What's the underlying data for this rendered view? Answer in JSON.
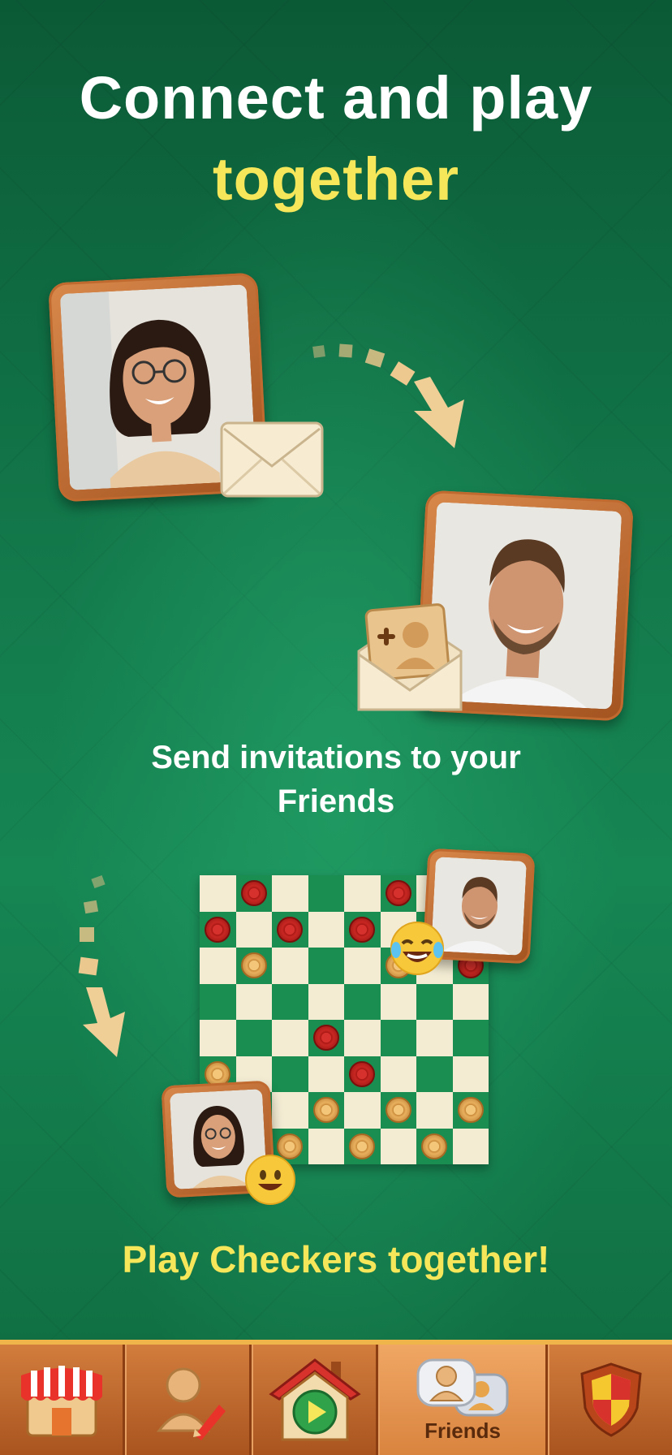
{
  "headline": {
    "line1": "Connect and play",
    "line2": "together"
  },
  "captions": {
    "invite": "Send invitations to your Friends",
    "play": "Play Checkers together!"
  },
  "board": {
    "rows": 8,
    "cols": 8,
    "pieces": [
      {
        "row": 0,
        "col": 1,
        "color": "red"
      },
      {
        "row": 0,
        "col": 5,
        "color": "red"
      },
      {
        "row": 1,
        "col": 0,
        "color": "red"
      },
      {
        "row": 1,
        "col": 2,
        "color": "red"
      },
      {
        "row": 1,
        "col": 4,
        "color": "red"
      },
      {
        "row": 2,
        "col": 1,
        "color": "gold"
      },
      {
        "row": 2,
        "col": 5,
        "color": "gold"
      },
      {
        "row": 2,
        "col": 7,
        "color": "red"
      },
      {
        "row": 4,
        "col": 3,
        "color": "red"
      },
      {
        "row": 5,
        "col": 0,
        "color": "gold"
      },
      {
        "row": 5,
        "col": 4,
        "color": "red"
      },
      {
        "row": 6,
        "col": 3,
        "color": "gold"
      },
      {
        "row": 6,
        "col": 5,
        "color": "gold"
      },
      {
        "row": 6,
        "col": 7,
        "color": "gold"
      },
      {
        "row": 7,
        "col": 2,
        "color": "gold"
      },
      {
        "row": 7,
        "col": 4,
        "color": "gold"
      },
      {
        "row": 7,
        "col": 6,
        "color": "gold"
      }
    ]
  },
  "nav": {
    "items": [
      {
        "id": "shop",
        "icon": "shop-icon",
        "label": ""
      },
      {
        "id": "profile",
        "icon": "profile-edit-icon",
        "label": ""
      },
      {
        "id": "home",
        "icon": "home-play-icon",
        "label": ""
      },
      {
        "id": "friends",
        "icon": "friends-icon",
        "label": "Friends",
        "active": true
      },
      {
        "id": "clan",
        "icon": "shield-icon",
        "label": ""
      }
    ]
  },
  "colors": {
    "accent_yellow": "#f6e65a",
    "wood": "#b9652c",
    "board_dark": "#198e50",
    "board_light": "#f3ecd3"
  }
}
